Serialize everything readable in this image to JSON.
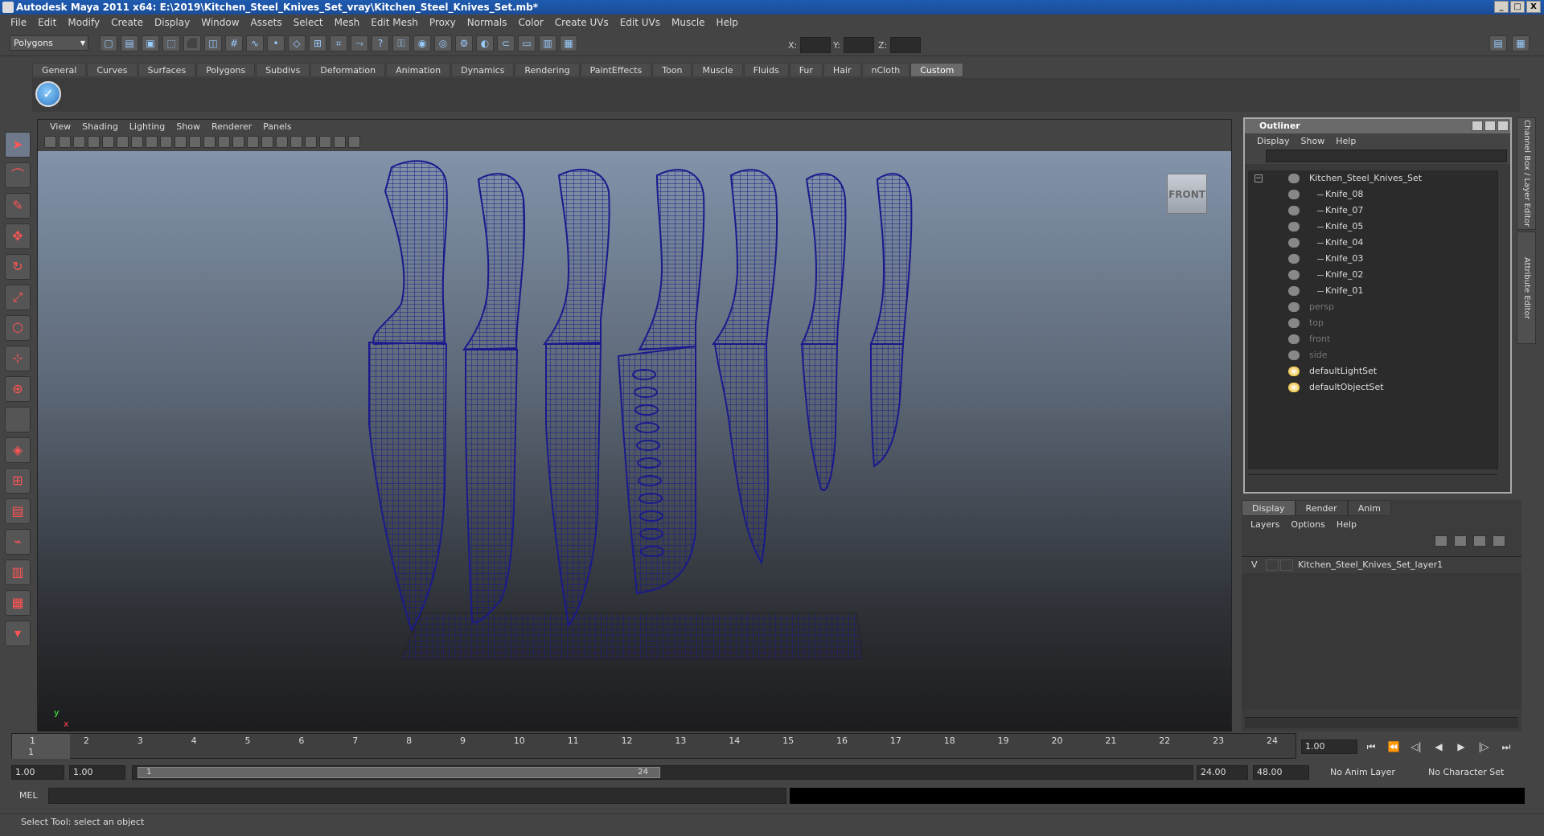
{
  "window": {
    "title": "Autodesk Maya 2011 x64: E:\\2019\\Kitchen_Steel_Knives_Set_vray\\Kitchen_Steel_Knives_Set.mb*",
    "controls": [
      "_",
      "□",
      "X"
    ]
  },
  "menubar": [
    "File",
    "Edit",
    "Modify",
    "Create",
    "Display",
    "Window",
    "Assets",
    "Select",
    "Mesh",
    "Edit Mesh",
    "Proxy",
    "Normals",
    "Color",
    "Create UVs",
    "Edit UVs",
    "Muscle",
    "Help"
  ],
  "status": {
    "mode": "Polygons",
    "x_label": "X:",
    "y_label": "Y:",
    "z_label": "Z:"
  },
  "shelf": {
    "tabs": [
      "General",
      "Curves",
      "Surfaces",
      "Polygons",
      "Subdivs",
      "Deformation",
      "Animation",
      "Dynamics",
      "Rendering",
      "PaintEffects",
      "Toon",
      "Muscle",
      "Fluids",
      "Fur",
      "Hair",
      "nCloth",
      "Custom"
    ],
    "active_tab": "Custom"
  },
  "viewport": {
    "menu": [
      "View",
      "Shading",
      "Lighting",
      "Show",
      "Renderer",
      "Panels"
    ],
    "view_cube_label": "FRONT",
    "axis_y": "y",
    "axis_x": "x",
    "wire_color": "#1a1a8c"
  },
  "outliner": {
    "title": "Outliner",
    "menu": [
      "Display",
      "Show",
      "Help"
    ],
    "root": "Kitchen_Steel_Knives_Set",
    "children": [
      "Knife_08",
      "Knife_07",
      "Knife_05",
      "Knife_04",
      "Knife_03",
      "Knife_02",
      "Knife_01"
    ],
    "cameras": [
      "persp",
      "top",
      "front",
      "side"
    ],
    "sets": [
      "defaultLightSet",
      "defaultObjectSet"
    ]
  },
  "side_tabs": [
    "Channel Box / Layer Editor",
    "Attribute Editor"
  ],
  "layer_editor": {
    "tabs": [
      "Display",
      "Render",
      "Anim"
    ],
    "active_tab": "Display",
    "menu": [
      "Layers",
      "Options",
      "Help"
    ],
    "layers": [
      {
        "visible": "V",
        "name": "Kitchen_Steel_Knives_Set_layer1"
      }
    ]
  },
  "timeline": {
    "frames": [
      "1",
      "2",
      "3",
      "4",
      "5",
      "6",
      "7",
      "8",
      "9",
      "10",
      "11",
      "12",
      "13",
      "14",
      "15",
      "16",
      "17",
      "18",
      "19",
      "20",
      "21",
      "22",
      "23",
      "24"
    ],
    "current_frame_label": "1",
    "current_time": "1.00"
  },
  "range": {
    "start_time": "1.00",
    "playback_start": "1.00",
    "slider_start": "1",
    "slider_end": "24",
    "playback_end": "24.00",
    "end_time": "48.00",
    "anim_layer": "No Anim Layer",
    "character_set": "No Character Set"
  },
  "command": {
    "label": "MEL"
  },
  "help_line": "Select Tool: select an object"
}
